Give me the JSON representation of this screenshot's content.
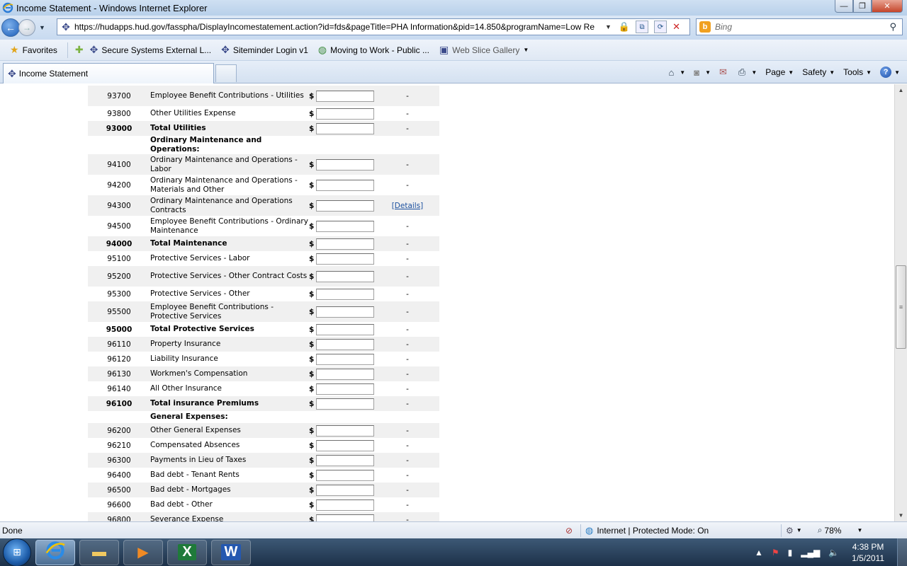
{
  "window": {
    "title": "Income Statement - Windows Internet Explorer",
    "minimize_glyph": "—",
    "restore_glyph": "❐",
    "close_glyph": "✕"
  },
  "address": {
    "url": "https://hudapps.hud.gov/fasspha/DisplayIncomestatement.action?id=fds&pageTitle=PHA Information&pid=14.850&programName=Low Re",
    "search_placeholder": "Bing"
  },
  "favorites": {
    "label": "Favorites",
    "items": [
      {
        "label": "Secure Systems External L..."
      },
      {
        "label": "Siteminder Login v1"
      },
      {
        "label": "Moving to Work - Public ..."
      },
      {
        "label": "Web Slice Gallery"
      }
    ]
  },
  "tabs": {
    "active_label": "Income Statement"
  },
  "commands": {
    "page": "Page",
    "safety": "Safety",
    "tools": "Tools",
    "help": "?"
  },
  "statement": {
    "currency": "$",
    "rows": [
      {
        "code": "93700",
        "desc": "Employee Benefit Contributions - Utilities",
        "action": "-",
        "shade": true,
        "kind": "line"
      },
      {
        "code": "93800",
        "desc": "Other Utilities Expense",
        "action": "-",
        "shade": false,
        "kind": "line"
      },
      {
        "code": "93000",
        "desc": "Total Utilities",
        "action": "-",
        "shade": true,
        "kind": "total"
      },
      {
        "code": "",
        "desc": "Ordinary Maintenance and Operations:",
        "action": "",
        "shade": false,
        "kind": "section"
      },
      {
        "code": "94100",
        "desc": "Ordinary Maintenance and Operations - Labor",
        "action": "-",
        "shade": true,
        "kind": "line"
      },
      {
        "code": "94200",
        "desc": "Ordinary Maintenance and Operations - Materials and Other",
        "action": "-",
        "shade": false,
        "kind": "line"
      },
      {
        "code": "94300",
        "desc": "Ordinary Maintenance and Operations Contracts",
        "action": "[Details]",
        "shade": true,
        "kind": "line"
      },
      {
        "code": "94500",
        "desc": "Employee Benefit Contributions - Ordinary Maintenance",
        "action": "-",
        "shade": false,
        "kind": "line"
      },
      {
        "code": "94000",
        "desc": "Total Maintenance",
        "action": "-",
        "shade": true,
        "kind": "total"
      },
      {
        "code": "95100",
        "desc": "Protective Services - Labor",
        "action": "-",
        "shade": false,
        "kind": "line"
      },
      {
        "code": "95200",
        "desc": "Protective Services - Other Contract Costs",
        "action": "-",
        "shade": true,
        "kind": "line"
      },
      {
        "code": "95300",
        "desc": "Protective Services - Other",
        "action": "-",
        "shade": false,
        "kind": "line"
      },
      {
        "code": "95500",
        "desc": "Employee Benefit Contributions - Protective Services",
        "action": "-",
        "shade": true,
        "kind": "line"
      },
      {
        "code": "95000",
        "desc": "Total Protective Services",
        "action": "-",
        "shade": false,
        "kind": "total"
      },
      {
        "code": "96110",
        "desc": "Property Insurance",
        "action": "-",
        "shade": true,
        "kind": "line"
      },
      {
        "code": "96120",
        "desc": "Liability Insurance",
        "action": "-",
        "shade": false,
        "kind": "line"
      },
      {
        "code": "96130",
        "desc": "Workmen's Compensation",
        "action": "-",
        "shade": true,
        "kind": "line"
      },
      {
        "code": "96140",
        "desc": "All Other Insurance",
        "action": "-",
        "shade": false,
        "kind": "line"
      },
      {
        "code": "96100",
        "desc": "Total insurance Premiums",
        "action": "-",
        "shade": true,
        "kind": "total"
      },
      {
        "code": "",
        "desc": "General Expenses:",
        "action": "",
        "shade": false,
        "kind": "section"
      },
      {
        "code": "96200",
        "desc": "Other General Expenses",
        "action": "-",
        "shade": true,
        "kind": "line"
      },
      {
        "code": "96210",
        "desc": "Compensated Absences",
        "action": "-",
        "shade": false,
        "kind": "line"
      },
      {
        "code": "96300",
        "desc": "Payments in Lieu of Taxes",
        "action": "-",
        "shade": true,
        "kind": "line"
      },
      {
        "code": "96400",
        "desc": "Bad debt - Tenant Rents",
        "action": "-",
        "shade": false,
        "kind": "line"
      },
      {
        "code": "96500",
        "desc": "Bad debt - Mortgages",
        "action": "-",
        "shade": true,
        "kind": "line"
      },
      {
        "code": "96600",
        "desc": "Bad debt - Other",
        "action": "-",
        "shade": false,
        "kind": "line"
      },
      {
        "code": "96800",
        "desc": "Severance Expense",
        "action": "-",
        "shade": true,
        "kind": "line"
      }
    ]
  },
  "status": {
    "text": "Done",
    "zone": "Internet | Protected Mode: On",
    "zoom": "78%"
  },
  "tray": {
    "time": "4:38 PM",
    "date": "1/5/2011"
  },
  "taskbar": {
    "excel_glyph": "X",
    "word_glyph": "W"
  }
}
